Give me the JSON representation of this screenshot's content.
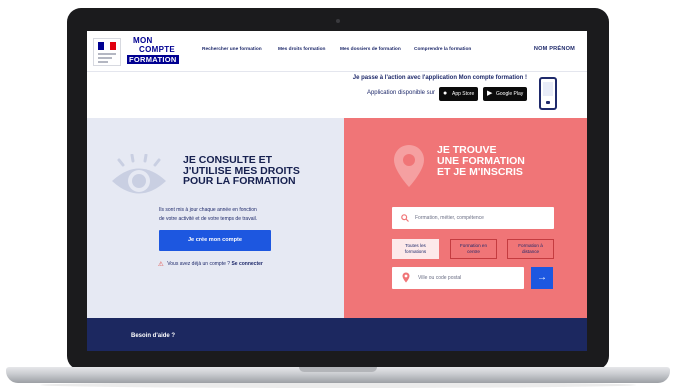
{
  "header": {
    "logo_line1": "MON",
    "logo_line2": "COMPTE",
    "logo_line3": "FORMATION",
    "nav": [
      {
        "label": "Rechercher une formation"
      },
      {
        "label": "Mes droits formation"
      },
      {
        "label": "Mes dossiers de formation"
      },
      {
        "label": "Comprendre la formation"
      }
    ],
    "user": "NOM PRÉNOM"
  },
  "banner": {
    "text1": "Je passe à l'action avec l'application Mon compte formation !",
    "text2": "Application disponible sur",
    "app_store": "App Store",
    "google_play": "Google Play"
  },
  "left": {
    "title": [
      "JE CONSULTE ET",
      "J'UTILISE MES DROITS",
      "POUR LA FORMATION"
    ],
    "text": [
      "Ils sont mis à jour chaque année en fonction",
      "de votre activité et de votre temps de travail."
    ],
    "create_button": "Je crée mon compte",
    "connect_prefix": "Vous avez déjà un compte ?",
    "connect_link": "Se connecter"
  },
  "right": {
    "title": [
      "JE TROUVE",
      "UNE FORMATION",
      "ET JE M'INSCRIS"
    ],
    "search_placeholder": "Formation, métier, compétence",
    "tabs": [
      {
        "lines": [
          "Toutes les",
          "formations"
        ]
      },
      {
        "lines": [
          "Formation en",
          "centre"
        ]
      },
      {
        "lines": [
          "Formation à",
          "distance"
        ]
      }
    ],
    "city_placeholder": "Ville ou code postal"
  },
  "footer": {
    "help": "Besoin d'aide ?"
  },
  "colors": {
    "primary_blue": "#000091",
    "button_blue": "#1d57e0",
    "coral": "#f07577",
    "left_bg": "#e6e9f3",
    "footer_navy": "#1c2860"
  },
  "icons": [
    "eye-icon",
    "location-pin-icon",
    "search-icon",
    "arrow-right-icon",
    "warning-icon",
    "apple-icon",
    "google-play-icon",
    "phone-icon"
  ]
}
